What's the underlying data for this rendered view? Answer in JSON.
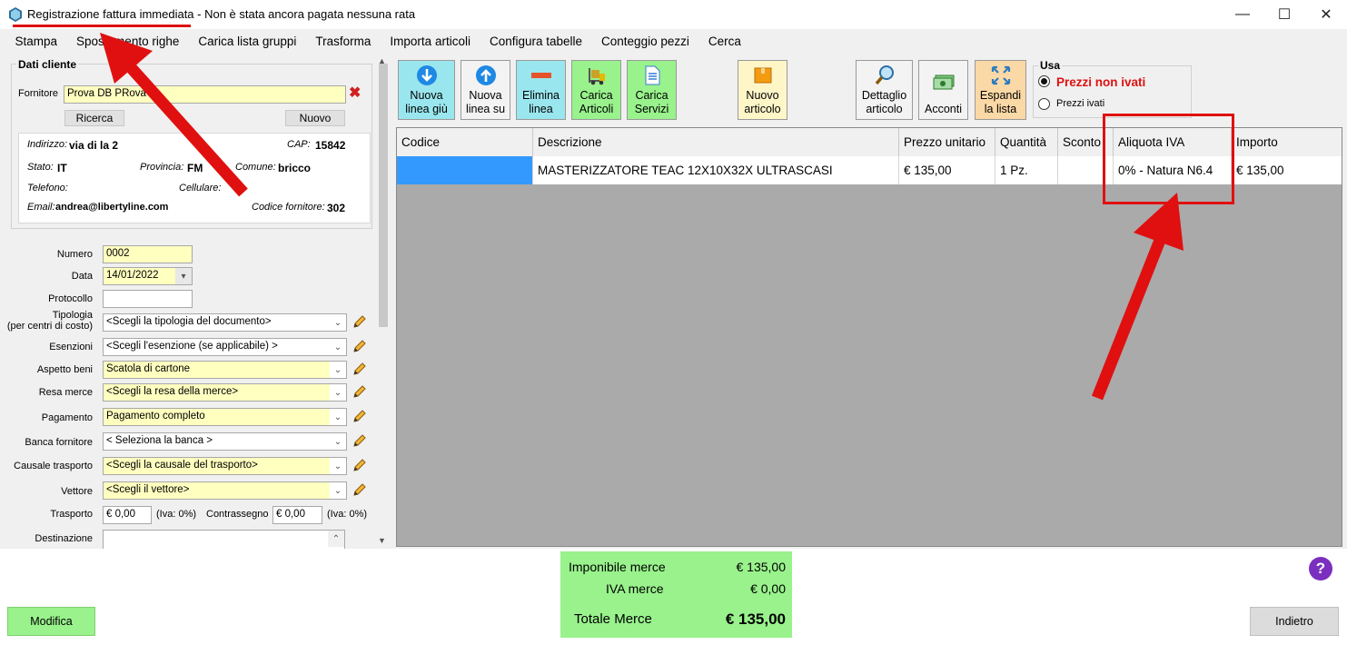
{
  "window": {
    "title_part1": "Registrazione fattura immediata",
    "title_part2": " - Non è stata ancora pagata nessuna rata",
    "minimize": "—",
    "maximize": "☐",
    "close": "✕"
  },
  "menu": [
    "Stampa",
    "Spostamento righe",
    "Carica lista gruppi",
    "Trasforma",
    "Importa articoli",
    "Configura tabelle",
    "Conteggio pezzi",
    "Cerca"
  ],
  "cliente": {
    "legend": "Dati cliente",
    "fornitore_label": "Fornitore",
    "fornitore_value": "Prova DB PRova",
    "ricerca": "Ricerca",
    "nuovo": "Nuovo",
    "indirizzo_label": "Indirizzo:",
    "indirizzo_value": "via di la 2",
    "cap_label": "CAP:",
    "cap_value": "15842",
    "stato_label": "Stato:",
    "stato_value": "IT",
    "provincia_label": "Provincia:",
    "provincia_value": "FM",
    "comune_label": "Comune:",
    "comune_value": "bricco",
    "telefono_label": "Telefono:",
    "cellulare_label": "Cellulare:",
    "email_label": "Email:",
    "email_value": "andrea@libertyline.com",
    "codice_label": "Codice fornitore:",
    "codice_value": "302"
  },
  "form": {
    "numero_label": "Numero",
    "numero_value": "0002",
    "data_label": "Data",
    "data_value": "14/01/2022",
    "protocollo_label": "Protocollo",
    "tipologia_label1": "Tipologia",
    "tipologia_label2": "(per centri di costo)",
    "tipologia_value": "<Scegli la tipologia del documento>",
    "esenzioni_label": "Esenzioni",
    "esenzioni_value": "<Scegli l'esenzione (se applicabile) >",
    "aspetto_label": "Aspetto beni",
    "aspetto_value": "Scatola di cartone",
    "resa_label": "Resa merce",
    "resa_value": "<Scegli la resa della merce>",
    "pagamento_label": "Pagamento",
    "pagamento_value": "Pagamento completo",
    "banca_label": "Banca fornitore",
    "banca_value": "< Seleziona la banca >",
    "causale_label": "Causale trasporto",
    "causale_value": "<Scegli la causale del trasporto>",
    "vettore_label": "Vettore",
    "vettore_value": "<Scegli il vettore>",
    "trasporto_label": "Trasporto",
    "trasporto_value": "€ 0,00",
    "trasporto_iva": "(Iva: 0%)",
    "contrassegno_label": "Contrassegno",
    "contrassegno_value": "€ 0,00",
    "contrassegno_iva": "(Iva: 0%)",
    "destinazione_label": "Destinazione"
  },
  "toolbar": {
    "nuova_giu_1": "Nuova",
    "nuova_giu_2": "linea giù",
    "nuova_su_1": "Nuova",
    "nuova_su_2": "linea su",
    "elimina_1": "Elimina",
    "elimina_2": "linea",
    "carica_art_1": "Carica",
    "carica_art_2": "Articoli",
    "carica_serv_1": "Carica",
    "carica_serv_2": "Servizi",
    "nuovo_art_1": "Nuovo",
    "nuovo_art_2": "articolo",
    "dettaglio_1": "Dettaglio",
    "dettaglio_2": "articolo",
    "acconti": "Acconti",
    "espandi_1": "Espandi",
    "espandi_2": "la lista"
  },
  "usa": {
    "legend": "Usa",
    "opt1": "Prezzi non ivati",
    "opt2": "Prezzi ivati",
    "selected": "Prezzi non ivati"
  },
  "grid": {
    "headers": [
      "Codice",
      "Descrizione",
      "Prezzo unitario",
      "Quantità",
      "Sconto",
      "Aliquota IVA",
      "Importo"
    ],
    "rows": [
      [
        "",
        "MASTERIZZATORE TEAC 12X10X32X ULTRASCASI",
        "€ 135,00",
        "1 Pz.",
        "",
        "0% - Natura N6.4",
        "€ 135,00"
      ]
    ]
  },
  "totals": {
    "imponibile_label": "Imponibile merce",
    "imponibile_value": "€ 135,00",
    "iva_label": "IVA merce",
    "iva_value": "€ 0,00",
    "totale_label": "Totale Merce",
    "totale_value": "€ 135,00"
  },
  "buttons": {
    "modifica": "Modifica",
    "indietro": "Indietro",
    "help": "?"
  },
  "colors": {
    "yellow_field": "#ffffc0",
    "green_button": "#99f28c",
    "annotation_red": "#e01010",
    "selected_cell": "#3399ff"
  }
}
